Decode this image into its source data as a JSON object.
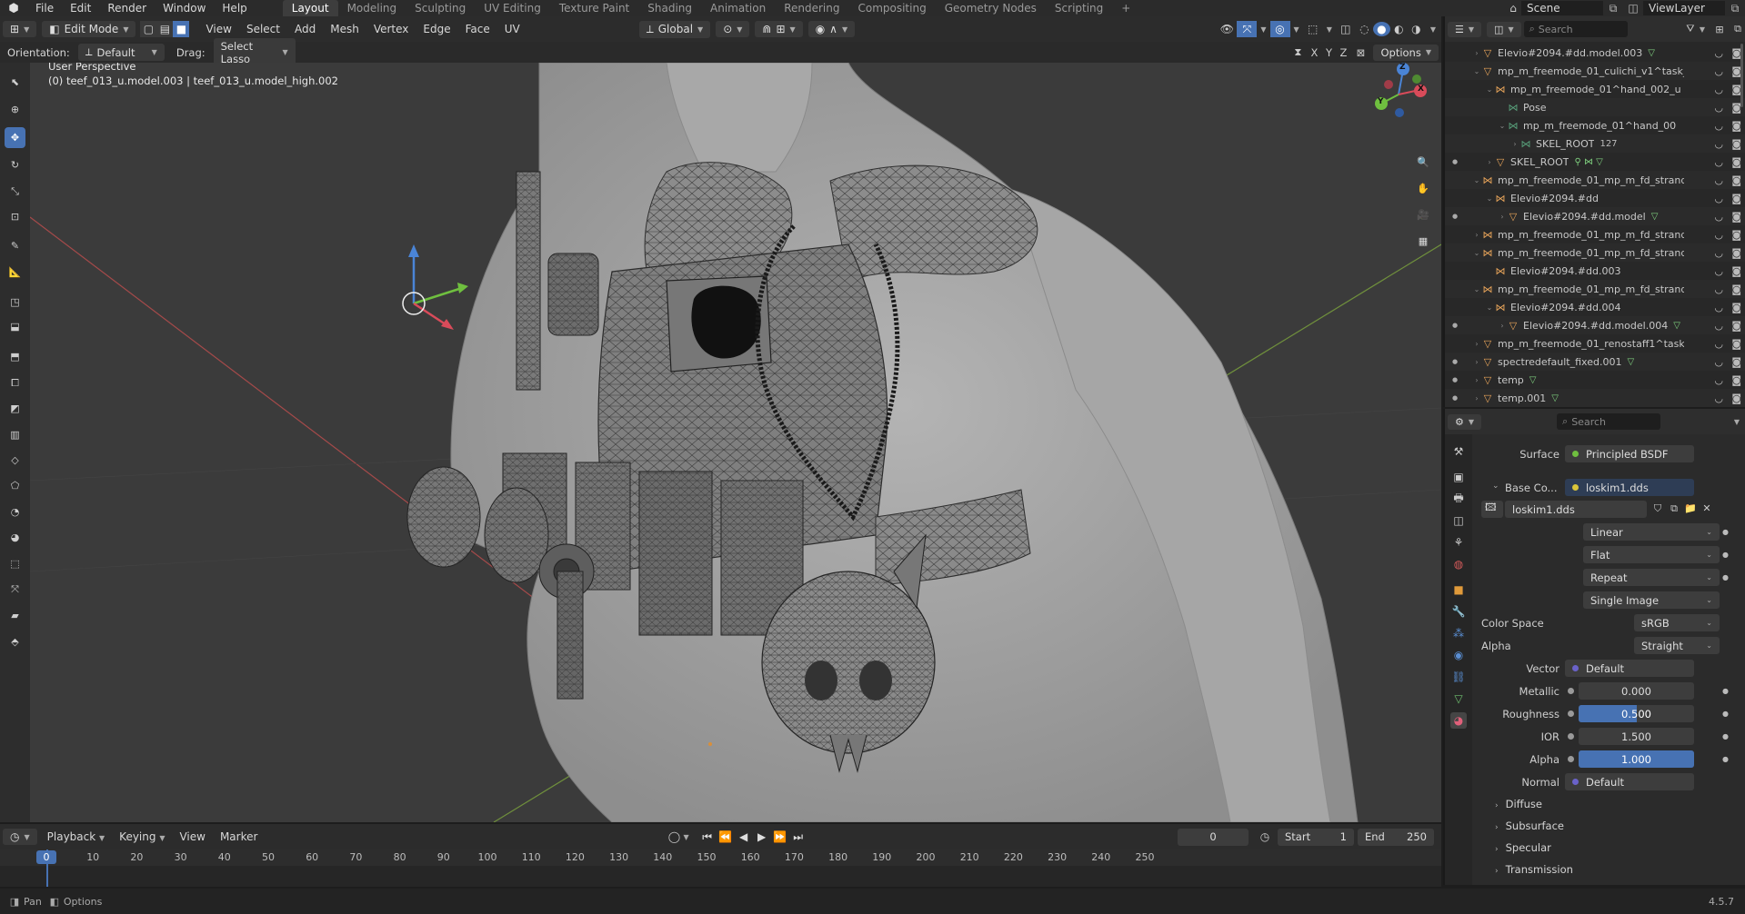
{
  "topbar": {
    "menus": [
      "File",
      "Edit",
      "Render",
      "Window",
      "Help"
    ],
    "workspaces": [
      "Layout",
      "Modeling",
      "Sculpting",
      "UV Editing",
      "Texture Paint",
      "Shading",
      "Animation",
      "Rendering",
      "Compositing",
      "Geometry Nodes",
      "Scripting"
    ],
    "active_workspace": "Layout",
    "scene": "Scene",
    "view_layer": "ViewLayer"
  },
  "viewport_header": {
    "mode": "Edit Mode",
    "menus": [
      "View",
      "Select",
      "Add",
      "Mesh",
      "Vertex",
      "Edge",
      "Face",
      "UV"
    ],
    "transform": "Global",
    "options": "Options",
    "axes": [
      "X",
      "Y",
      "Z"
    ]
  },
  "tool_settings": {
    "orientation_label": "Orientation:",
    "orientation_value": "Default",
    "drag_label": "Drag:",
    "drag_value": "Select Lasso"
  },
  "viewport": {
    "perspective": "User Perspective",
    "object_info": "(0) teef_013_u.model.003 | teef_013_u.model_high.002",
    "gizmo_axes": [
      "X",
      "Y",
      "Z"
    ]
  },
  "outliner": {
    "search_placeholder": "Search",
    "rows": [
      {
        "indent": 1,
        "tri": "›",
        "icon": "▽",
        "icolor": "#e8a45a",
        "name": "Elevio#2094.#dd.model.003",
        "extra": "▽",
        "xcolor": "#7fd17f",
        "dot": false
      },
      {
        "indent": 1,
        "tri": "⌄",
        "icon": "▽",
        "icolor": "#e8a45a",
        "name": "mp_m_freemode_01_culichi_v1^task_",
        "extra": "",
        "xcolor": "",
        "dot": false
      },
      {
        "indent": 2,
        "tri": "⌄",
        "icon": "⋈",
        "icolor": "#e8a45a",
        "name": "mp_m_freemode_01^hand_002_u",
        "extra": "",
        "xcolor": "",
        "dot": false
      },
      {
        "indent": 3,
        "tri": "",
        "icon": "⋈",
        "icolor": "#58a07a",
        "name": "Pose",
        "extra": "",
        "xcolor": "",
        "dot": false
      },
      {
        "indent": 3,
        "tri": "⌄",
        "icon": "⋈",
        "icolor": "#58a07a",
        "name": "mp_m_freemode_01^hand_00",
        "extra": "",
        "xcolor": "",
        "dot": false
      },
      {
        "indent": 4,
        "tri": "›",
        "icon": "⋈",
        "icolor": "#58a07a",
        "name": "SKEL_ROOT",
        "extra": "127",
        "xcolor": "#bbb",
        "dot": false
      },
      {
        "indent": 2,
        "tri": "›",
        "icon": "▽",
        "icolor": "#e8a45a",
        "name": "SKEL_ROOT",
        "extra": "⚲ ⋈ ▽",
        "xcolor": "#7fd17f",
        "dot": true
      },
      {
        "indent": 1,
        "tri": "⌄",
        "icon": "⋈",
        "icolor": "#e8a45a",
        "name": "mp_m_freemode_01_mp_m_fd_strand",
        "extra": "",
        "xcolor": "",
        "dot": false
      },
      {
        "indent": 2,
        "tri": "⌄",
        "icon": "⋈",
        "icolor": "#e8a45a",
        "name": "Elevio#2094.#dd",
        "extra": "",
        "xcolor": "",
        "dot": false
      },
      {
        "indent": 3,
        "tri": "›",
        "icon": "▽",
        "icolor": "#e8a45a",
        "name": "Elevio#2094.#dd.model",
        "extra": "▽",
        "xcolor": "#7fd17f",
        "dot": true
      },
      {
        "indent": 1,
        "tri": "›",
        "icon": "⋈",
        "icolor": "#e8a45a",
        "name": "mp_m_freemode_01_mp_m_fd_strand",
        "extra": "",
        "xcolor": "",
        "dot": false
      },
      {
        "indent": 1,
        "tri": "⌄",
        "icon": "⋈",
        "icolor": "#e8a45a",
        "name": "mp_m_freemode_01_mp_m_fd_strand",
        "extra": "",
        "xcolor": "",
        "dot": false
      },
      {
        "indent": 2,
        "tri": "",
        "icon": "⋈",
        "icolor": "#e8a45a",
        "name": "Elevio#2094.#dd.003",
        "extra": "",
        "xcolor": "",
        "dot": false
      },
      {
        "indent": 1,
        "tri": "⌄",
        "icon": "⋈",
        "icolor": "#e8a45a",
        "name": "mp_m_freemode_01_mp_m_fd_strand",
        "extra": "",
        "xcolor": "",
        "dot": false
      },
      {
        "indent": 2,
        "tri": "⌄",
        "icon": "⋈",
        "icolor": "#e8a45a",
        "name": "Elevio#2094.#dd.004",
        "extra": "",
        "xcolor": "",
        "dot": false
      },
      {
        "indent": 3,
        "tri": "›",
        "icon": "▽",
        "icolor": "#e8a45a",
        "name": "Elevio#2094.#dd.model.004",
        "extra": "▽",
        "xcolor": "#7fd17f",
        "dot": true
      },
      {
        "indent": 1,
        "tri": "›",
        "icon": "▽",
        "icolor": "#e8a45a",
        "name": "mp_m_freemode_01_renostaff1^task_",
        "extra": "",
        "xcolor": "",
        "dot": false
      },
      {
        "indent": 1,
        "tri": "›",
        "icon": "▽",
        "icolor": "#e8a45a",
        "name": "spectredefault_fixed.001",
        "extra": "▽",
        "xcolor": "#7fd17f",
        "dot": true
      },
      {
        "indent": 1,
        "tri": "›",
        "icon": "▽",
        "icolor": "#e8a45a",
        "name": "temp",
        "extra": "▽",
        "xcolor": "#7fd17f",
        "dot": true
      },
      {
        "indent": 1,
        "tri": "›",
        "icon": "▽",
        "icolor": "#e8a45a",
        "name": "temp.001",
        "extra": "▽",
        "xcolor": "#7fd17f",
        "dot": true
      }
    ]
  },
  "properties": {
    "search_placeholder": "Search",
    "surface_label": "Surface",
    "surface_value": "Principled BSDF",
    "base_color_label": "Base Co...",
    "base_color_value": "loskim1.dds",
    "image_name": "loskim1.dds",
    "interpolation": "Linear",
    "projection": "Flat",
    "extension": "Repeat",
    "source": "Single Image",
    "color_space_label": "Color Space",
    "color_space_value": "sRGB",
    "alpha_mode_label": "Alpha",
    "alpha_mode_value": "Straight",
    "vector_label": "Vector",
    "vector_value": "Default",
    "metallic_label": "Metallic",
    "metallic_value": "0.000",
    "roughness_label": "Roughness",
    "roughness_value": "0.500",
    "roughness_fill": 0.5,
    "ior_label": "IOR",
    "ior_value": "1.500",
    "alpha_label": "Alpha",
    "alpha_value": "1.000",
    "alpha_fill": 1.0,
    "normal_label": "Normal",
    "normal_value": "Default",
    "sections": [
      "Diffuse",
      "Subsurface",
      "Specular",
      "Transmission"
    ]
  },
  "timeline": {
    "menus": [
      "Playback",
      "Keying",
      "View",
      "Marker"
    ],
    "current_frame": "0",
    "start_label": "Start",
    "start_value": "1",
    "end_label": "End",
    "end_value": "250",
    "ruler": [
      "0",
      "10",
      "20",
      "30",
      "40",
      "50",
      "60",
      "70",
      "80",
      "90",
      "100",
      "110",
      "120",
      "130",
      "140",
      "150",
      "160",
      "170",
      "180",
      "190",
      "200",
      "210",
      "220",
      "230",
      "240",
      "250"
    ]
  },
  "statusbar": {
    "pan": "Pan",
    "options": "Options",
    "version": "4.5.7"
  }
}
